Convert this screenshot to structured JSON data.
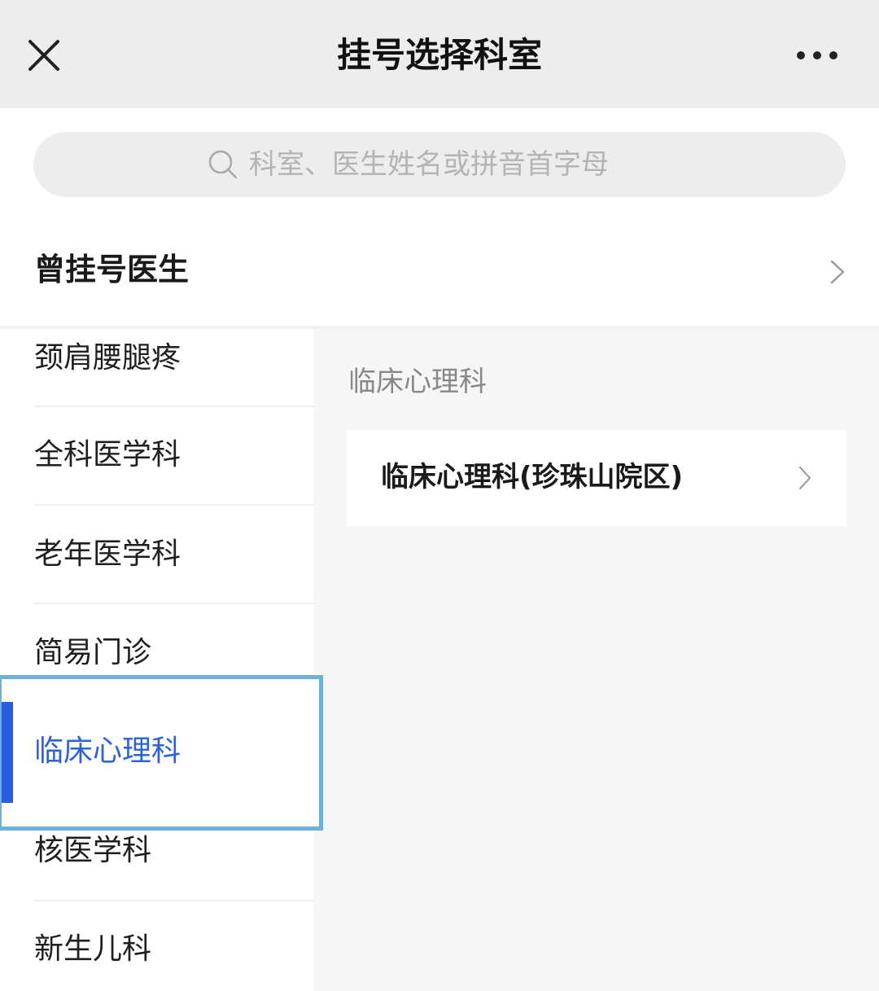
{
  "header": {
    "title": "挂号选择科室",
    "close_icon": "close-icon",
    "more_icon": "more-icon"
  },
  "search": {
    "placeholder": "科室、医生姓名或拼音首字母",
    "value": "",
    "icon": "search-icon"
  },
  "history": {
    "label": "曾挂号医生",
    "icon": "chevron-right-icon"
  },
  "sidebar": {
    "items": [
      {
        "label": "颈肩腰腿疼",
        "selected": false
      },
      {
        "label": "全科医学科",
        "selected": false
      },
      {
        "label": "老年医学科",
        "selected": false
      },
      {
        "label": "简易门诊",
        "selected": false
      },
      {
        "label": "临床心理科",
        "selected": true
      },
      {
        "label": "核医学科",
        "selected": false
      },
      {
        "label": "新生儿科",
        "selected": false
      }
    ]
  },
  "content": {
    "section_title": "临床心理科",
    "departments": [
      {
        "name": "临床心理科(珍珠山院区)"
      }
    ]
  },
  "colors": {
    "header_bg": "#ededed",
    "accent": "#2a5be0",
    "selected_text": "#2d63d8",
    "highlight_outline": "#6cb1d9",
    "content_bg": "#f6f6f7"
  }
}
